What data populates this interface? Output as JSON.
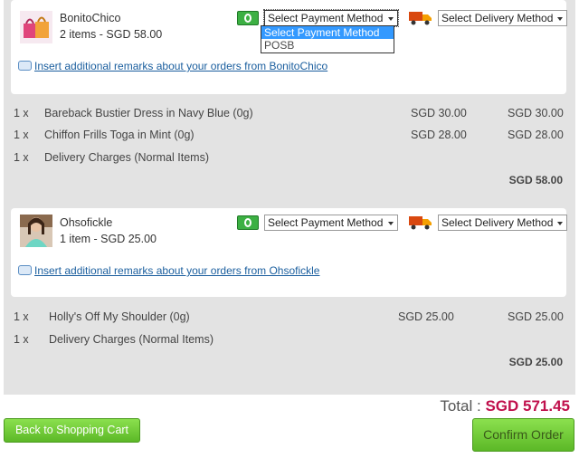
{
  "orders": [
    {
      "shop_name": "BonitoChico",
      "summary": "2 items - SGD 58.00",
      "payment_select": "Select Payment Method",
      "delivery_select": "Select Delivery Method",
      "remarks_link": "Insert additional remarks about your orders from BonitoChico",
      "items": [
        {
          "qty": "1 x",
          "name": "Bareback Bustier Dress in Navy Blue (0g)",
          "price": "SGD 30.00",
          "total": "SGD 30.00"
        },
        {
          "qty": "1 x",
          "name": "Chiffon Frills Toga in Mint (0g)",
          "price": "SGD 28.00",
          "total": "SGD 28.00"
        },
        {
          "qty": "1 x",
          "name": "Delivery Charges (Normal Items)",
          "price": "",
          "total": ""
        }
      ],
      "subtotal": "SGD 58.00"
    },
    {
      "shop_name": "Ohsofickle",
      "summary": "1 item - SGD 25.00",
      "payment_select": "Select Payment Method",
      "delivery_select": "Select Delivery Method",
      "remarks_link": "Insert additional remarks about your orders from Ohsofickle",
      "items": [
        {
          "qty": "1 x",
          "name": "Holly's Off My Shoulder (0g)",
          "price": "SGD 25.00",
          "total": "SGD 25.00"
        },
        {
          "qty": "1 x",
          "name": "Delivery Charges (Normal Items)",
          "price": "",
          "total": ""
        }
      ],
      "subtotal": "SGD 25.00"
    }
  ],
  "payment_dropdown": {
    "options": [
      "Select Payment Method",
      "POSB"
    ],
    "highlighted": "Select Payment Method"
  },
  "total": {
    "label": "Total :",
    "amount": "SGD 571.45"
  },
  "buttons": {
    "back": "Back to Shopping Cart",
    "confirm": "Confirm Order"
  },
  "colors": {
    "accent_total": "#c0104c",
    "button_green": "#6cc832",
    "link": "#1a5e9e",
    "panel_bg": "#e3e3e3"
  },
  "icons": {
    "payment": "money-icon",
    "delivery": "truck-icon",
    "remarks": "speech-bubble-icon"
  }
}
